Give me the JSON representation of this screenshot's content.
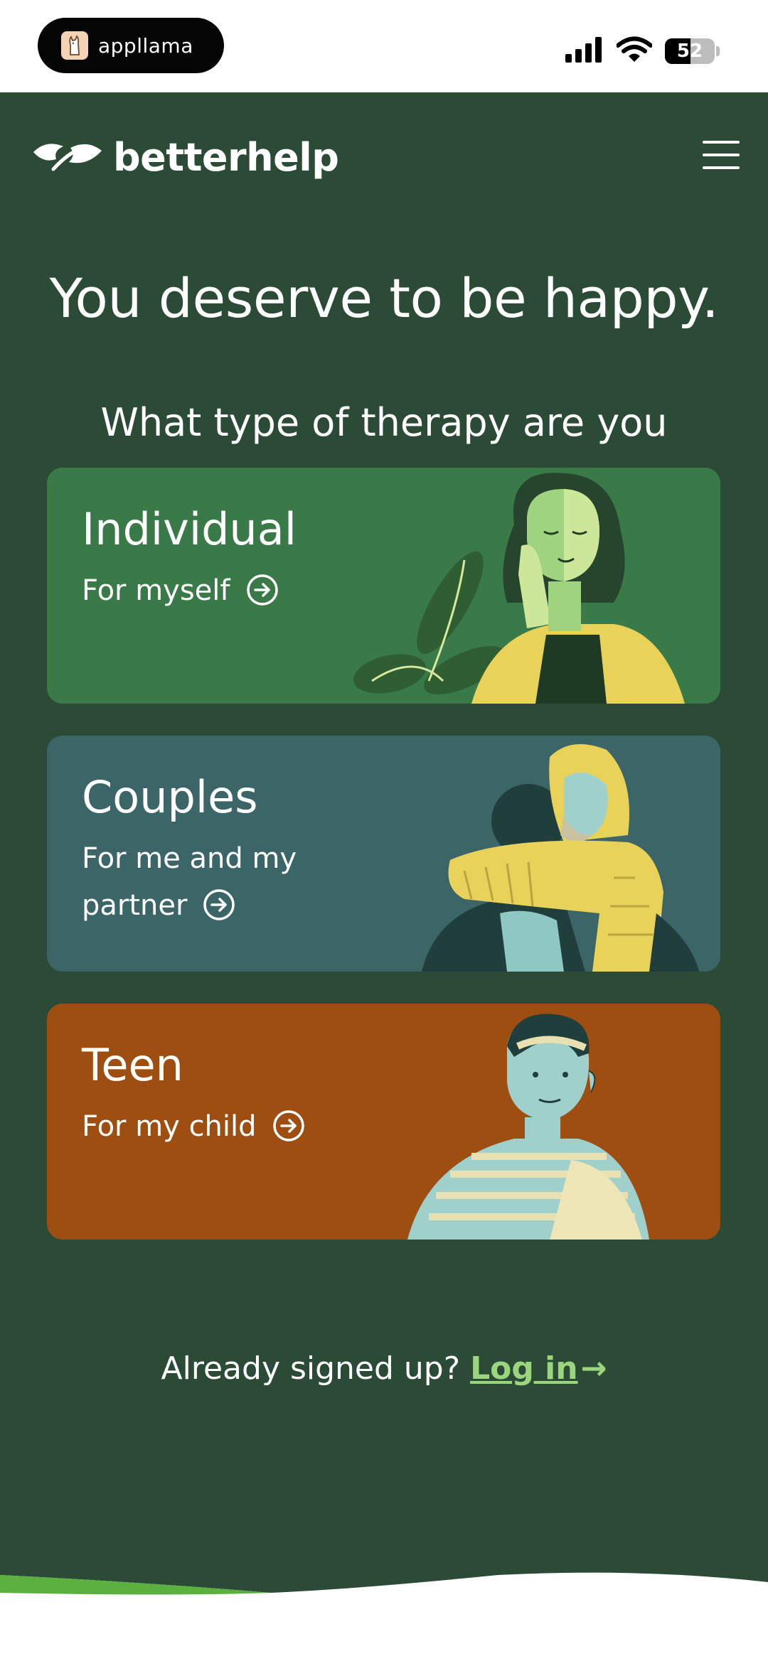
{
  "status_bar": {
    "app_name": "appllama",
    "battery_level": "52",
    "battery_fraction": 0.52,
    "icons": [
      "signal-icon",
      "wifi-icon",
      "battery-icon"
    ]
  },
  "header": {
    "brand": "betterhelp",
    "logo_icon": "leaf-hands-logo-icon",
    "menu_icon": "hamburger-menu-icon"
  },
  "hero": {
    "headline": "You deserve to be happy.",
    "question": "What type of therapy are you looking for?"
  },
  "cards": [
    {
      "title": "Individual",
      "subtitle": "For myself",
      "color": "#3a7a48",
      "icon": "arrow-right-circle-icon"
    },
    {
      "title": "Couples",
      "subtitle": "For me and my partner",
      "color": "#3c6567",
      "icon": "arrow-right-circle-icon"
    },
    {
      "title": "Teen",
      "subtitle": "For my child",
      "color": "#9e4e10",
      "icon": "arrow-right-circle-icon"
    }
  ],
  "login": {
    "prompt": "Already signed up?",
    "link": "Log in",
    "arrow": "→"
  },
  "colors": {
    "background": "#2c4b36",
    "accent": "#9bd67e"
  }
}
